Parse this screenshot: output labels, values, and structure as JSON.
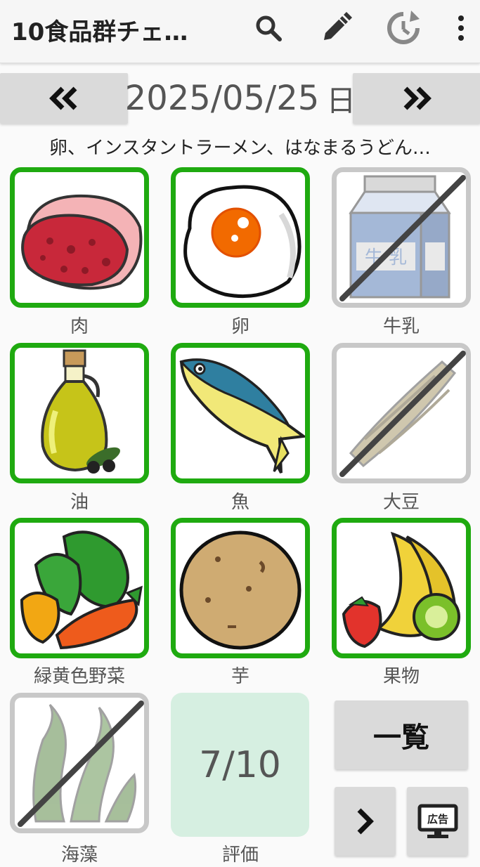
{
  "appbar": {
    "title": "10食品群チェ…",
    "icons": [
      "search-icon",
      "pencil-icon",
      "history-icon",
      "more-vert-icon"
    ]
  },
  "datebar": {
    "prev_icon": "double-chevron-left-icon",
    "next_icon": "double-chevron-right-icon",
    "date": "2025/05/25",
    "weekday": "日"
  },
  "meal_summary": "卵、インスタントラーメン、はなまるうどん…",
  "food_groups": [
    {
      "label": "肉",
      "checked": true
    },
    {
      "label": "卵",
      "checked": true
    },
    {
      "label": "牛乳",
      "checked": false
    },
    {
      "label": "油",
      "checked": true
    },
    {
      "label": "魚",
      "checked": true
    },
    {
      "label": "大豆",
      "checked": false
    },
    {
      "label": "緑黄色野菜",
      "checked": true
    },
    {
      "label": "芋",
      "checked": true
    },
    {
      "label": "果物",
      "checked": true
    },
    {
      "label": "海藻",
      "checked": false
    }
  ],
  "evaluation": {
    "score": "7/10",
    "label": "評価"
  },
  "buttons": {
    "list_label": "一覧",
    "next_icon": "chevron-right-icon",
    "ad_icon": "ad-monitor-icon",
    "ad_text": "広告"
  },
  "colors": {
    "checked_border": "#1faa10",
    "unchecked_border": "#c8c8c8",
    "score_bg": "#d6efe1"
  }
}
